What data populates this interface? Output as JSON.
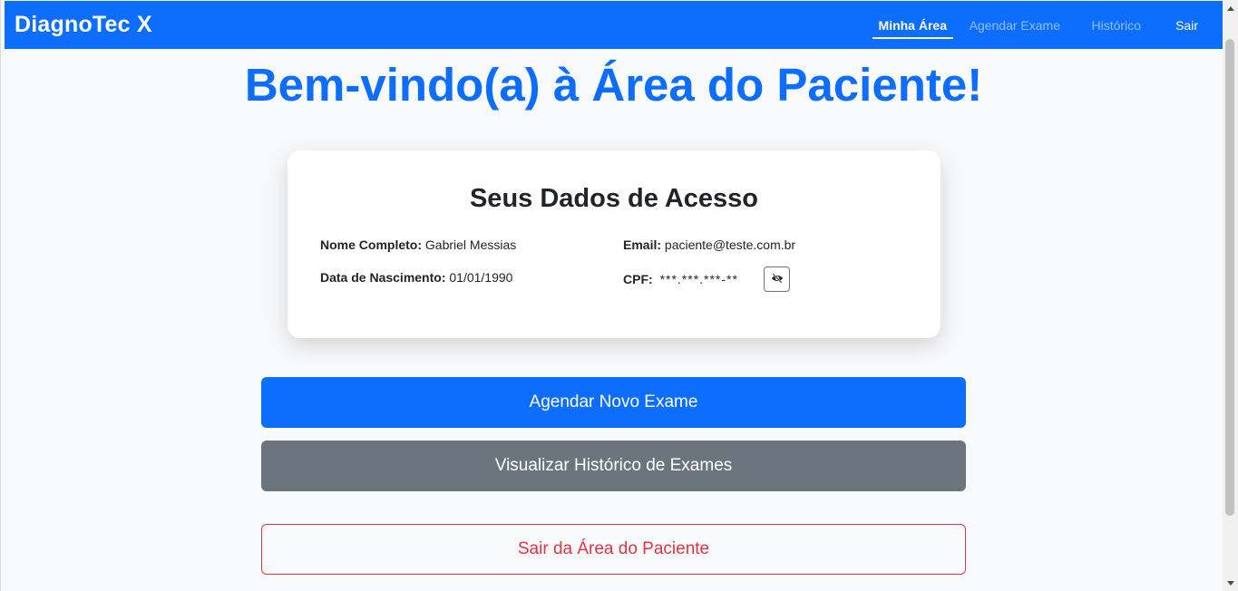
{
  "navbar": {
    "brand": "DiagnoTec X",
    "links": [
      {
        "label": "Minha Área",
        "active": true
      },
      {
        "label": "Agendar Exame",
        "active": false
      },
      {
        "label": "Histórico",
        "active": false
      },
      {
        "label": "Sair",
        "active": false
      }
    ]
  },
  "page": {
    "title": "Bem-vindo(a) à Área do Paciente!"
  },
  "card": {
    "title": "Seus Dados de Acesso",
    "fields": {
      "name_label": "Nome Completo:",
      "name_value": "Gabriel Messias",
      "email_label": "Email:",
      "email_value": "paciente@teste.com.br",
      "birth_label": "Data de Nascimento:",
      "birth_value": "01/01/1990",
      "cpf_label": "CPF:",
      "cpf_value": "***.***.***-**"
    },
    "toggle_icon": "eye-slash-icon"
  },
  "actions": {
    "schedule": "Agendar Novo Exame",
    "history": "Visualizar Histórico de Exames",
    "logout": "Sair da Área do Paciente"
  },
  "colors": {
    "primary": "#0d6efd",
    "secondary": "#6c757d",
    "danger": "#dc3545",
    "background": "#f8f9fa"
  }
}
